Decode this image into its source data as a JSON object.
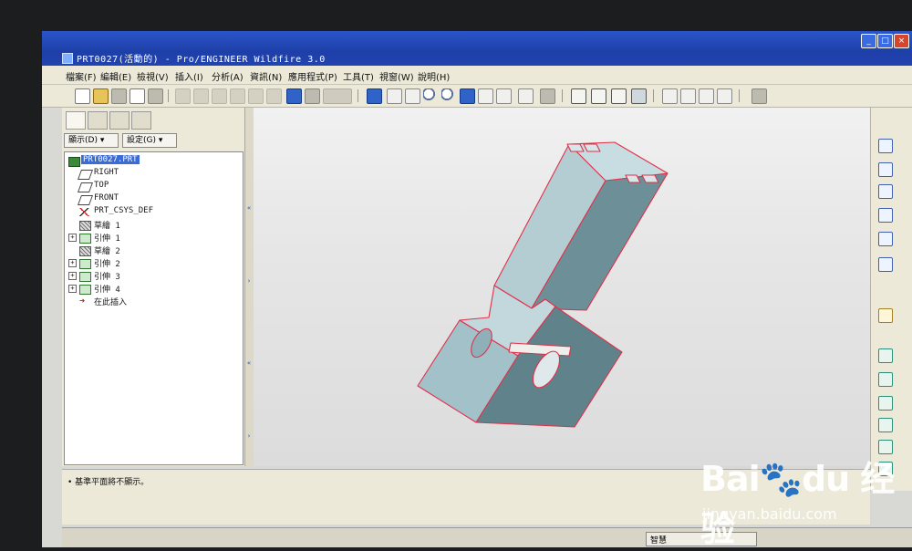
{
  "window": {
    "title": "PRT0027(活動的) - Pro/ENGINEER Wildfire 3.0",
    "min_label": "_",
    "max_label": "□",
    "close_label": "×"
  },
  "menubar": {
    "items": [
      "檔案(F)",
      "編輯(E)",
      "檢視(V)",
      "插入(I)",
      "分析(A)",
      "資訊(N)",
      "應用程式(P)",
      "工具(T)",
      "視窗(W)",
      "說明(H)"
    ]
  },
  "navigator": {
    "show_label": "顯示(D) ▾",
    "settings_label": "設定(G) ▾",
    "tree": [
      {
        "label": "PRT0027.PRT",
        "icon": "part-icon",
        "expand": false
      },
      {
        "label": "RIGHT",
        "icon": "datum-plane-icon",
        "expand": false
      },
      {
        "label": "TOP",
        "icon": "datum-plane-icon",
        "expand": false
      },
      {
        "label": "FRONT",
        "icon": "datum-plane-icon",
        "expand": false
      },
      {
        "label": "PRT_CSYS_DEF",
        "icon": "csys-icon",
        "expand": false
      },
      {
        "label": "草繪 1",
        "icon": "sketch-icon",
        "expand": false
      },
      {
        "label": "引伸 1",
        "icon": "extrude-icon",
        "expand": true
      },
      {
        "label": "草繪 2",
        "icon": "sketch-icon",
        "expand": false
      },
      {
        "label": "引伸 2",
        "icon": "extrude-icon",
        "expand": true
      },
      {
        "label": "引伸 3",
        "icon": "extrude-icon",
        "expand": true
      },
      {
        "label": "引伸 4",
        "icon": "extrude-icon",
        "expand": true
      },
      {
        "label": "在此插入",
        "icon": "insert-here-icon",
        "expand": false
      }
    ]
  },
  "message_area": {
    "message": "• 基準平面將不顯示。"
  },
  "status_bar": {
    "filter": "智慧"
  },
  "watermark": {
    "brand": "Bai🐾du 经验",
    "url": "jingyan.baidu.com"
  },
  "colors": {
    "title_bar": "#1e3fa8",
    "model_face": "#a9c6cc",
    "model_edge": "#e0304a",
    "graphics_bg": "#e6e6e6"
  }
}
